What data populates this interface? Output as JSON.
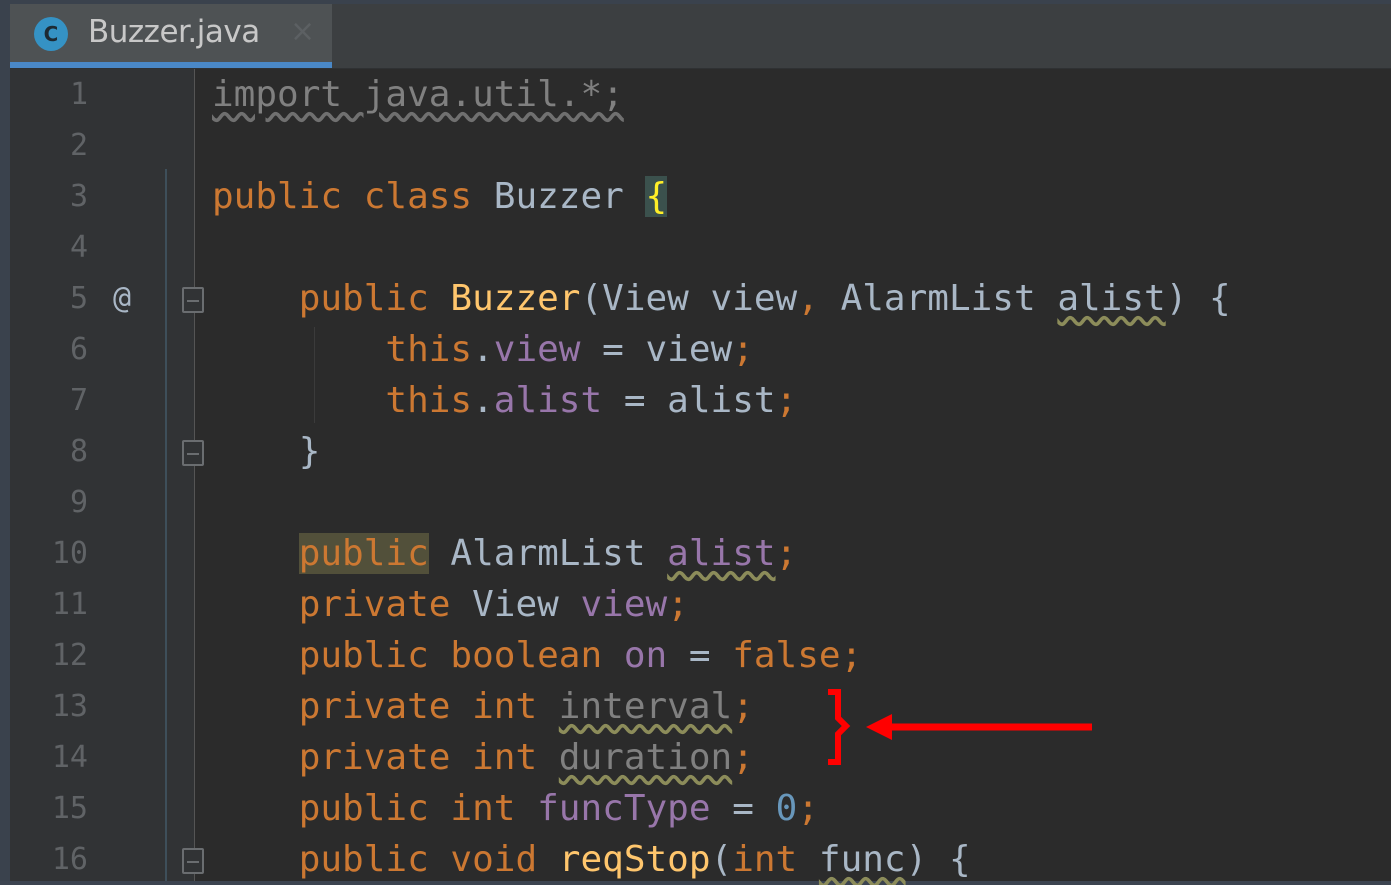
{
  "tab": {
    "icon_letter": "C",
    "title": "Buzzer.java",
    "close_glyph": "×"
  },
  "editor": {
    "lines": [
      {
        "num": "1"
      },
      {
        "num": "2"
      },
      {
        "num": "3"
      },
      {
        "num": "4"
      },
      {
        "num": "5",
        "marker": "@"
      },
      {
        "num": "6"
      },
      {
        "num": "7"
      },
      {
        "num": "8"
      },
      {
        "num": "9"
      },
      {
        "num": "10"
      },
      {
        "num": "11"
      },
      {
        "num": "12"
      },
      {
        "num": "13"
      },
      {
        "num": "14"
      },
      {
        "num": "15"
      },
      {
        "num": "16"
      }
    ]
  },
  "colors": {
    "keyword": "#cc7832",
    "field": "#9876aa",
    "number": "#6897bb",
    "method": "#ffc66d",
    "annotation_red": "#ff0000"
  }
}
